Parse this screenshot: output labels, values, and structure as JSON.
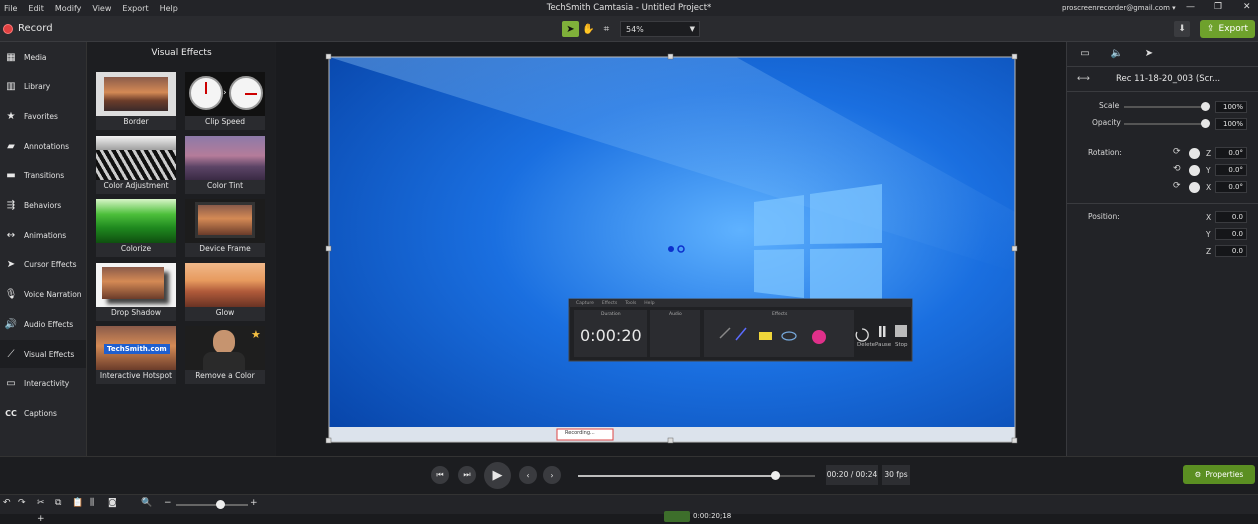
{
  "menubar": {
    "items": [
      "File",
      "Edit",
      "Modify",
      "View",
      "Export",
      "Help"
    ],
    "title": "TechSmith Camtasia - Untitled Project*",
    "account": "proscreenrecorder@gmail.com ▾"
  },
  "toolbar": {
    "record_label": "Record",
    "zoom_value": "54%",
    "export_label": "Export"
  },
  "sidebar": {
    "items": [
      {
        "label": "Media",
        "icon": "media-icon"
      },
      {
        "label": "Library",
        "icon": "library-icon"
      },
      {
        "label": "Favorites",
        "icon": "star-icon"
      },
      {
        "label": "Annotations",
        "icon": "annotations-icon"
      },
      {
        "label": "Transitions",
        "icon": "transitions-icon"
      },
      {
        "label": "Behaviors",
        "icon": "behaviors-icon"
      },
      {
        "label": "Animations",
        "icon": "animations-icon"
      },
      {
        "label": "Cursor Effects",
        "icon": "cursor-icon"
      },
      {
        "label": "Voice Narration",
        "icon": "microphone-icon"
      },
      {
        "label": "Audio Effects",
        "icon": "speaker-icon"
      },
      {
        "label": "Visual Effects",
        "icon": "wand-icon"
      },
      {
        "label": "Interactivity",
        "icon": "interactivity-icon"
      },
      {
        "label": "Captions",
        "icon": "cc-icon"
      }
    ]
  },
  "effects": {
    "title": "Visual Effects",
    "items": [
      {
        "label": "Border"
      },
      {
        "label": "Clip Speed"
      },
      {
        "label": "Color Adjustment"
      },
      {
        "label": "Color Tint"
      },
      {
        "label": "Colorize"
      },
      {
        "label": "Device Frame"
      },
      {
        "label": "Drop Shadow"
      },
      {
        "label": "Glow"
      },
      {
        "label": "Interactive Hotspot",
        "overlay": "TechSmith.com"
      },
      {
        "label": "Remove a Color"
      }
    ]
  },
  "recorder": {
    "time": "0:00:20",
    "menu": [
      "Capture",
      "Effects",
      "Tools",
      "Help"
    ],
    "buttons": [
      "Delete",
      "Pause",
      "Stop"
    ],
    "section_labels": [
      "Duration",
      "Audio",
      "Effects"
    ],
    "taskbar_task": "Recording..."
  },
  "properties": {
    "clip_name": "Rec 11-18-20_003 (Scr...",
    "scale_label": "Scale",
    "scale_value": "100%",
    "scale": 1.0,
    "opacity_label": "Opacity",
    "opacity_value": "100%",
    "opacity": 1.0,
    "rotation_label": "Rotation:",
    "rotation": {
      "z": "0.0°",
      "y": "0.0°",
      "x": "0.0°"
    },
    "position_label": "Position:",
    "position": {
      "x": "0.0",
      "y": "0.0",
      "z": "0.0"
    },
    "axis": {
      "x": "X",
      "y": "Y",
      "z": "Z"
    },
    "button_label": "Properties"
  },
  "transport": {
    "time": "00:20 / 00:24",
    "fps": "30 fps",
    "progress": 0.83
  },
  "timeline": {
    "playhead_time": "0:00:20;18"
  }
}
